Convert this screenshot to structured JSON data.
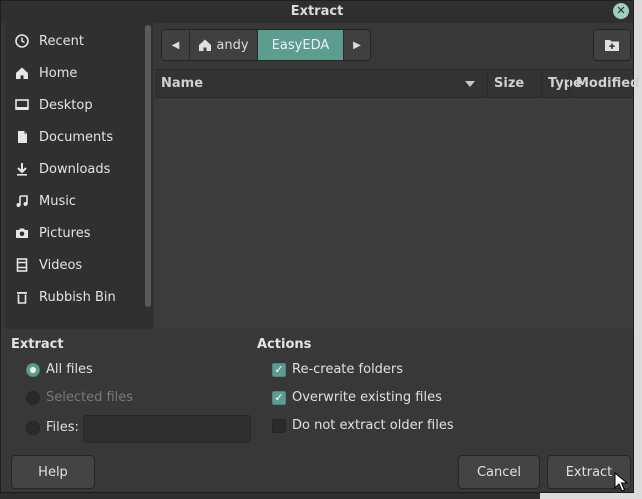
{
  "window": {
    "title": "Extract"
  },
  "sidebar": {
    "items": [
      {
        "label": "Recent",
        "icon": "clock-icon"
      },
      {
        "label": "Home",
        "icon": "home-icon"
      },
      {
        "label": "Desktop",
        "icon": "desktop-icon"
      },
      {
        "label": "Documents",
        "icon": "document-icon"
      },
      {
        "label": "Downloads",
        "icon": "download-icon"
      },
      {
        "label": "Music",
        "icon": "music-icon"
      },
      {
        "label": "Pictures",
        "icon": "camera-icon"
      },
      {
        "label": "Videos",
        "icon": "film-icon"
      },
      {
        "label": "Rubbish Bin",
        "icon": "trash-icon"
      }
    ]
  },
  "pathbar": {
    "segments": [
      "andy",
      "EasyEDA"
    ],
    "current": "EasyEDA"
  },
  "filelist": {
    "columns": [
      "Name",
      "Size",
      "Type",
      "Modified"
    ]
  },
  "extract": {
    "heading": "Extract",
    "all_files": "All files",
    "selected_files": "Selected files",
    "files_label": "Files:",
    "files_value": "",
    "selected_option": "All files"
  },
  "actions": {
    "heading": "Actions",
    "recreate_folders": {
      "label": "Re-create folders",
      "checked": true
    },
    "overwrite": {
      "label": "Overwrite existing files",
      "checked": true
    },
    "no_older": {
      "label": "Do not extract older files",
      "checked": false
    }
  },
  "buttons": {
    "help": "Help",
    "cancel": "Cancel",
    "extract": "Extract"
  },
  "colors": {
    "accent": "#5b9e8f",
    "background": "#383838"
  }
}
